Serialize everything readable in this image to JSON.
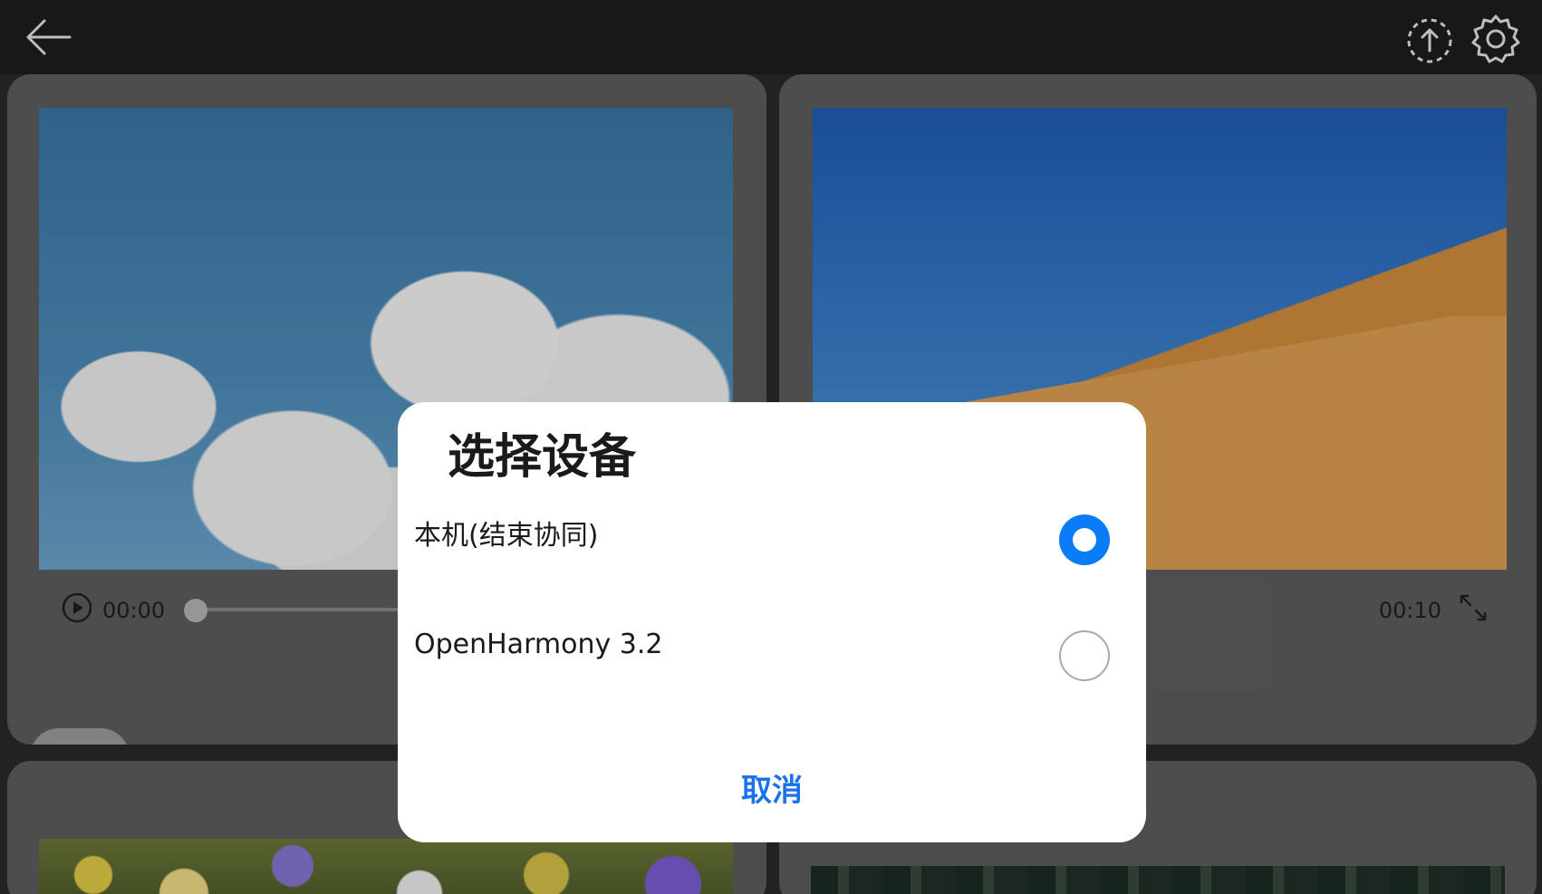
{
  "topbar": {
    "back_icon": "arrow-left-icon",
    "sync_icon": "sync-clock-icon",
    "settings_icon": "gear-icon"
  },
  "videos": [
    {
      "time_start": "00:00",
      "scene": "sky-clouds"
    },
    {
      "time_end": "00:10",
      "scene": "desert-dune"
    }
  ],
  "dialog": {
    "title": "选择设备",
    "options": [
      {
        "label": "本机(结束协同)",
        "selected": true
      },
      {
        "label": "OpenHarmony 3.2",
        "selected": false
      }
    ],
    "cancel_label": "取消"
  },
  "colors": {
    "accent": "#0a7cf5",
    "cancel_text": "#1a73e8"
  }
}
